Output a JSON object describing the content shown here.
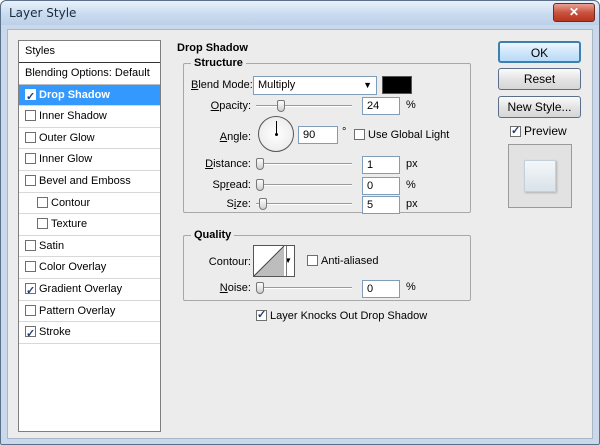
{
  "window": {
    "title": "Layer Style"
  },
  "styles": {
    "header": "Styles",
    "blending_options": "Blending Options: Default",
    "items": [
      {
        "label": "Drop Shadow",
        "checked": true,
        "selected": true,
        "indent": false
      },
      {
        "label": "Inner Shadow",
        "checked": false,
        "selected": false,
        "indent": false
      },
      {
        "label": "Outer Glow",
        "checked": false,
        "selected": false,
        "indent": false
      },
      {
        "label": "Inner Glow",
        "checked": false,
        "selected": false,
        "indent": false
      },
      {
        "label": "Bevel and Emboss",
        "checked": false,
        "selected": false,
        "indent": false
      },
      {
        "label": "Contour",
        "checked": false,
        "selected": false,
        "indent": true
      },
      {
        "label": "Texture",
        "checked": false,
        "selected": false,
        "indent": true
      },
      {
        "label": "Satin",
        "checked": false,
        "selected": false,
        "indent": false
      },
      {
        "label": "Color Overlay",
        "checked": false,
        "selected": false,
        "indent": false
      },
      {
        "label": "Gradient Overlay",
        "checked": true,
        "selected": false,
        "indent": false
      },
      {
        "label": "Pattern Overlay",
        "checked": false,
        "selected": false,
        "indent": false
      },
      {
        "label": "Stroke",
        "checked": true,
        "selected": false,
        "indent": false
      }
    ]
  },
  "drop_shadow": {
    "title": "Drop Shadow",
    "structure": {
      "title": "Structure",
      "blend_mode_label": "Blend Mode:",
      "blend_mode_value": "Multiply",
      "shadow_color": "#000000",
      "opacity_label": "Opacity:",
      "opacity_value": "24",
      "opacity_unit": "%",
      "angle_label": "Angle:",
      "angle_value": "90",
      "angle_unit": "°",
      "use_global_light_label": "Use Global Light",
      "use_global_light_checked": false,
      "distance_label": "Distance:",
      "distance_value": "1",
      "distance_unit": "px",
      "spread_label": "Spread:",
      "spread_value": "0",
      "spread_unit": "%",
      "size_label": "Size:",
      "size_value": "5",
      "size_unit": "px"
    },
    "quality": {
      "title": "Quality",
      "contour_label": "Contour:",
      "anti_aliased_label": "Anti-aliased",
      "anti_aliased_checked": false,
      "noise_label": "Noise:",
      "noise_value": "0",
      "noise_unit": "%"
    },
    "knockout_label": "Layer Knocks Out Drop Shadow",
    "knockout_checked": true
  },
  "buttons": {
    "ok": "OK",
    "reset": "Reset",
    "new_style": "New Style...",
    "preview_label": "Preview",
    "preview_checked": true
  }
}
